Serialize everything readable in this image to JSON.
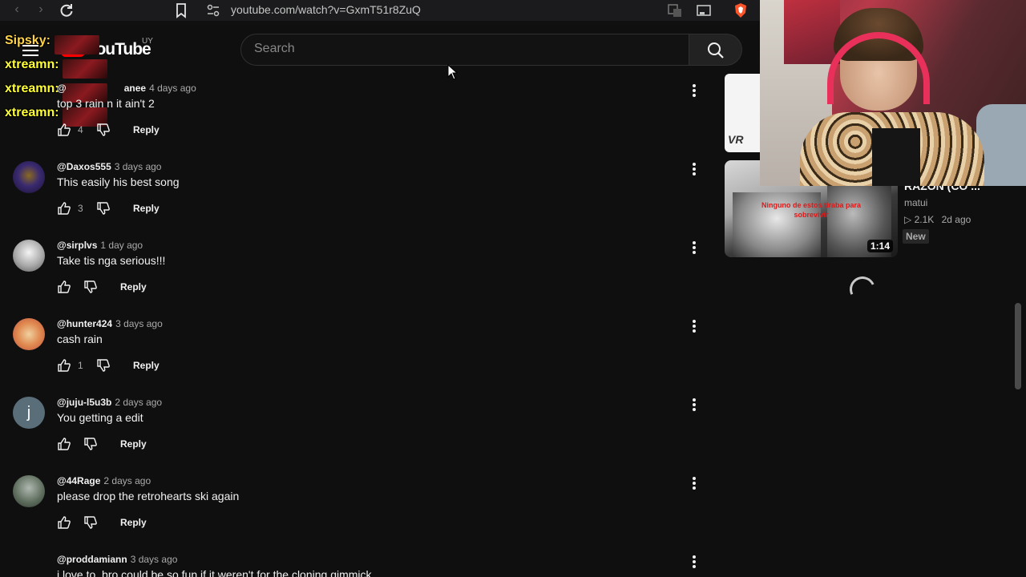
{
  "browser": {
    "url": "youtube.com/watch?v=GxmT51r8ZuQ",
    "brave_badge": "13"
  },
  "youtube": {
    "logo_text": "YouTube",
    "country_code": "UY",
    "search_placeholder": "Search"
  },
  "stream_chat": [
    {
      "name": "Sipsky:",
      "color": "#ffd34a"
    },
    {
      "name": "xtreamn:",
      "color": "#ffff33"
    },
    {
      "name": "xtreamn:",
      "color": "#ffff33"
    },
    {
      "name": "xtreamn:",
      "color": "#ffff33"
    }
  ],
  "comments": [
    {
      "author": "@",
      "author_suffix": "anee",
      "time": "4 days ago",
      "text": "top 3 rain n it ain't 2",
      "likes": "4"
    },
    {
      "author": "@Daxos555",
      "time": "3 days ago",
      "text": "This easily his best song",
      "likes": "3"
    },
    {
      "author": "@sirplvs",
      "time": "1 day ago",
      "text": "Take tis nga serious!!!",
      "likes": ""
    },
    {
      "author": "@hunter424",
      "time": "3 days ago",
      "text": "cash rain",
      "likes": "1"
    },
    {
      "author": "@juju-l5u3b",
      "time": "2 days ago",
      "text": "You getting a edit",
      "likes": "",
      "avatar_letter": "j"
    },
    {
      "author": "@44Rage",
      "time": "2 days ago",
      "text": "please drop the retrohearts ski again",
      "likes": ""
    },
    {
      "author": "@proddamiann",
      "time": "3 days ago",
      "text": "i love to, bro could be so fun if it weren't for the cloning gimmick",
      "likes": ""
    }
  ],
  "reply_label": "Reply",
  "sidebar": {
    "top_thumb_text": "VR",
    "video_title": "RAZON (CO ...",
    "thumb_caption": "Ninguno de estos tiraba para sobrevivir",
    "duration": "1:14",
    "channel": "matui",
    "views": "2.1K",
    "age": "2d ago",
    "badge": "New"
  },
  "colors": {
    "background": "#0f0f0f",
    "text": "#f1f1f1",
    "secondary_text": "#aaaaaa",
    "brand_red": "#ff0000"
  }
}
